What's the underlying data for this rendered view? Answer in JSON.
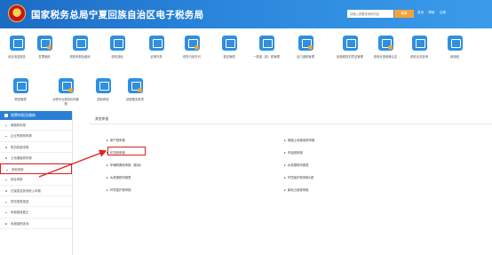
{
  "header": {
    "title": "国家税务总局宁夏回族自治区电子税务局",
    "search_placeholder": "请输入您要查询的内容",
    "search_button": "搜索",
    "links": [
      "首页",
      "帮助",
      "注销"
    ]
  },
  "services": [
    {
      "label": "综合信息报告"
    },
    {
      "label": "发票使用"
    },
    {
      "label": "税费申报及缴纳"
    },
    {
      "label": "税收减免"
    },
    {
      "label": "证明开具"
    },
    {
      "label": "税务行政许可"
    },
    {
      "label": "核定管理"
    },
    {
      "label": "一般退（抵）税管理"
    },
    {
      "label": "出口退税管理"
    },
    {
      "label": "增值税抵扣凭证管理"
    },
    {
      "label": "税收优惠资格认定"
    },
    {
      "label": "税收业务咨询"
    },
    {
      "label": "增值税"
    }
  ],
  "services_row2": [
    {
      "label": "稽查管理"
    },
    {
      "label": "涉税专业服务机构管理"
    },
    {
      "label": "国际税收"
    },
    {
      "label": "纳税服务事项"
    }
  ],
  "sidebar": {
    "title": "税费申报及缴纳",
    "items": [
      {
        "label": "增值税申报"
      },
      {
        "label": "企业所得税申报"
      },
      {
        "label": "附加税费申报"
      },
      {
        "label": "土地增值税申报"
      },
      {
        "label": "其他申报"
      },
      {
        "label": "综合申报"
      },
      {
        "label": "社保费及其他收入申报"
      },
      {
        "label": "财务报表报送"
      },
      {
        "label": "申报错误更正"
      },
      {
        "label": "申报缴税查询"
      }
    ],
    "active_index": 4
  },
  "main": {
    "title": "其他申报",
    "left_items": [
      {
        "label": "房产税申报"
      },
      {
        "label": "印花税申报"
      },
      {
        "label": "车辆购置税申报（新版）"
      },
      {
        "label": "水资源税申报表"
      },
      {
        "label": "环境保护税申报"
      }
    ],
    "right_items": [
      {
        "label": "城镇土地使用税申报"
      },
      {
        "label": "车船税申报"
      },
      {
        "label": "水资源税申报表"
      },
      {
        "label": "环境保护税申报A表"
      },
      {
        "label": "耕地占用税申报"
      }
    ],
    "highlight_index": 1
  }
}
